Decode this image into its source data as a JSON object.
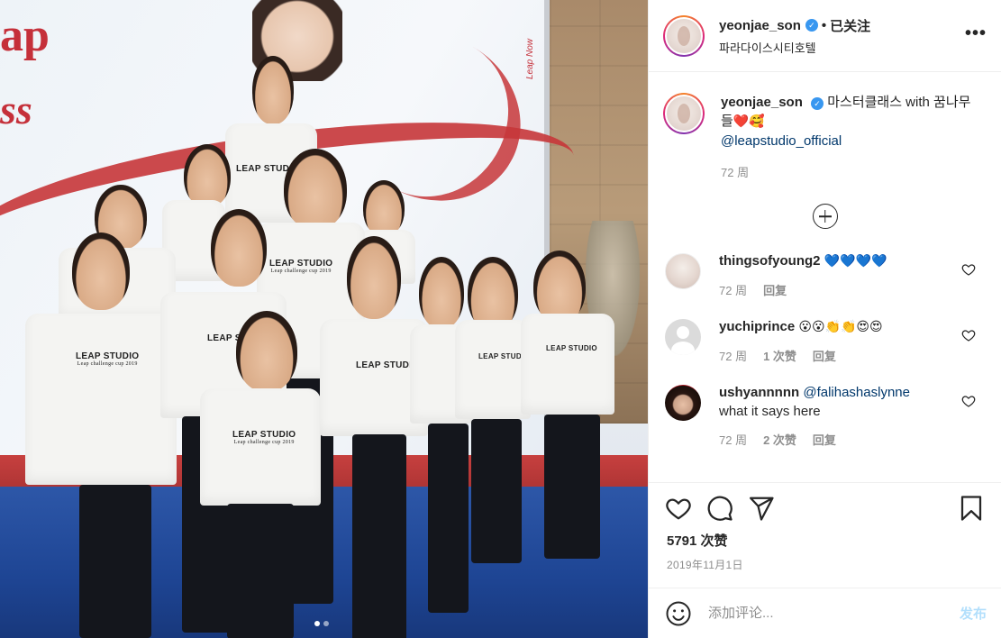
{
  "header": {
    "username": "yeonjae_son",
    "follow_status": "已关注",
    "separator": "•",
    "location": "파라다이스시티호텔",
    "more_label": "•••"
  },
  "caption": {
    "username": "yeonjae_son",
    "text": "마스터클래스 with 꿈나무들",
    "emojis": "❤️🥰",
    "mention": "@leapstudio_official",
    "time": "72 周"
  },
  "comments": [
    {
      "username": "thingsofyoung2",
      "text": "💙💙💙💙",
      "time": "72 周",
      "likes": "",
      "reply": "回复"
    },
    {
      "username": "yuchiprince",
      "text": "😮😮👏👏😍😍",
      "time": "72 周",
      "likes": "1 次赞",
      "reply": "回复"
    },
    {
      "username": "ushyannnnn",
      "mention": "@falihashaslynne",
      "text": "what it says here",
      "time": "72 周",
      "likes": "2 次赞",
      "reply": "回复"
    }
  ],
  "actions": {
    "likes": "5791 次赞",
    "date": "2019年11月1日"
  },
  "add_comment": {
    "placeholder": "添加评论...",
    "post_label": "发布"
  },
  "photo": {
    "banner_top": "ap",
    "banner_bottom": "ss",
    "side_text": "Leap Now",
    "shirt_logo": "LEAP STUDIO",
    "shirt_sub": "Leap challenge cup 2019"
  },
  "colors": {
    "accent_blue": "#3897f0",
    "mention_blue": "#00376b",
    "muted_text": "#8e8e8e",
    "post_button": "#b2dffc",
    "border": "#efefef"
  }
}
